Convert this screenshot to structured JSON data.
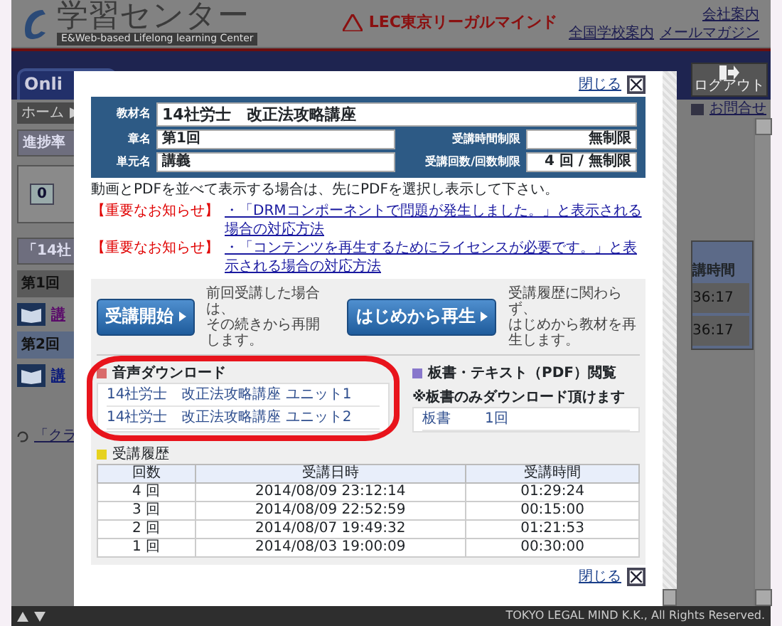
{
  "header": {
    "title": "学習センター",
    "subtitle": "E&Web-based Lifelong learning Center",
    "brand": "LEC東京リーガルマインド",
    "links": [
      "会社案内",
      "全国学校案内",
      "メールマガジン"
    ]
  },
  "nav": {
    "tab": "Onli",
    "logout": "ログアウト",
    "contact": "お問合せ"
  },
  "background": {
    "breadcrumb": "ホーム",
    "breadcrumb_sep": "▶",
    "progress_title": "進捗率",
    "progress_value": "0",
    "course_title": "「14社",
    "chapters": [
      {
        "title": "第1回",
        "link": "講",
        "visited": true
      },
      {
        "title": "第2回",
        "link": "講",
        "visited": false
      }
    ],
    "class_link": "「クラ",
    "column_header": "講時間",
    "times": [
      "36:17",
      "36:17"
    ]
  },
  "modal": {
    "close_top": "閉じる",
    "info": {
      "course_label": "教材名",
      "course": "14社労士　改正法攻略講座",
      "chapter_label": "章名",
      "chapter": "第1回",
      "unit_label": "単元名",
      "unit": "講義",
      "limit_label": "受講時間制限",
      "limit": "無制限",
      "count_label": "受講回数/回数制限",
      "count": "4 回 / 無制限"
    },
    "note": "動画とPDFを並べて表示する場合は、先にPDFを選択し表示して下さい。",
    "notices": [
      {
        "tag": "【重要なお知らせ】",
        "link": "・「DRMコンポーネントで問題が発生しました。」と表示される場合の対応方法"
      },
      {
        "tag": "【重要なお知らせ】",
        "link": "・「コンテンツを再生するためにライセンスが必要です。」と表示される場合の対応方法"
      }
    ],
    "actions": [
      {
        "label": "受講開始",
        "description": [
          "前回受講した場合は、",
          "その続きから再開します。"
        ]
      },
      {
        "label": "はじめから再生",
        "description": [
          "受講履歴に関わらず、",
          "はじめから教材を再生します。"
        ]
      }
    ],
    "audio": {
      "title": "音声ダウンロード",
      "color": "#d96b6b",
      "items": [
        "14社労士　改正法攻略講座 ユニット1",
        "14社労士　改正法攻略講座 ユニット2"
      ]
    },
    "pdf": {
      "title": "板書・テキスト（PDF）閲覧",
      "note": "※板書のみダウンロード頂けます",
      "color": "#8877cc",
      "items": [
        {
          "name": "板書",
          "count": "1回"
        }
      ]
    },
    "history": {
      "title": "受講履歴",
      "color": "#e6d21e",
      "columns": [
        "回数",
        "受講日時",
        "受講時間"
      ],
      "rows": [
        [
          "4 回",
          "2014/08/09 23:12:14",
          "01:29:24"
        ],
        [
          "3 回",
          "2014/08/09 22:52:59",
          "00:15:00"
        ],
        [
          "2 回",
          "2014/08/07 19:49:32",
          "01:21:53"
        ],
        [
          "1 回",
          "2014/08/03 19:00:09",
          "00:30:00"
        ]
      ]
    },
    "close_bottom": "閉じる"
  },
  "footer": {
    "copyright": "TOKYO LEGAL MIND K.K., All Rights Reserved."
  }
}
